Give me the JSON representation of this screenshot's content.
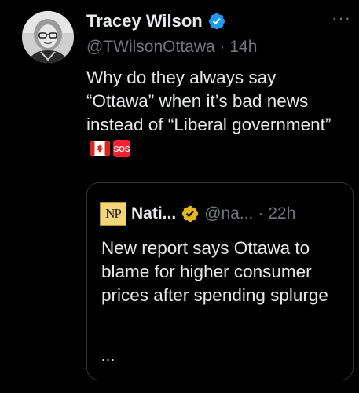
{
  "tweet": {
    "author": {
      "display_name": "Tracey Wilson",
      "handle": "@TWilsonOttawa",
      "verified": true,
      "avatar_icon": "profile-photo"
    },
    "separator": "·",
    "time": "14h",
    "text": "Why do they always say “Ottawa” when it’s bad news instead of “Liberal government”",
    "emojis": [
      "canada-flag-icon",
      "sos-icon"
    ],
    "more_label": "···"
  },
  "quote": {
    "logo_text": "NP",
    "author_name": "Nati...",
    "verified_type": "gold",
    "handle": "@na...",
    "separator": "·",
    "time": "22h",
    "text": "New report says Ottawa to blame for higher consumer prices after spending splurge",
    "ellipsis": "..."
  },
  "colors": {
    "background": "#000000",
    "text_primary": "#e7e9ea",
    "text_secondary": "#71767b",
    "verified_blue": "#1d9bf0",
    "verified_gold": "#e2b719",
    "card_border": "#2f3336",
    "canada_red": "#d52b1e",
    "sos_red": "#f4212e"
  }
}
